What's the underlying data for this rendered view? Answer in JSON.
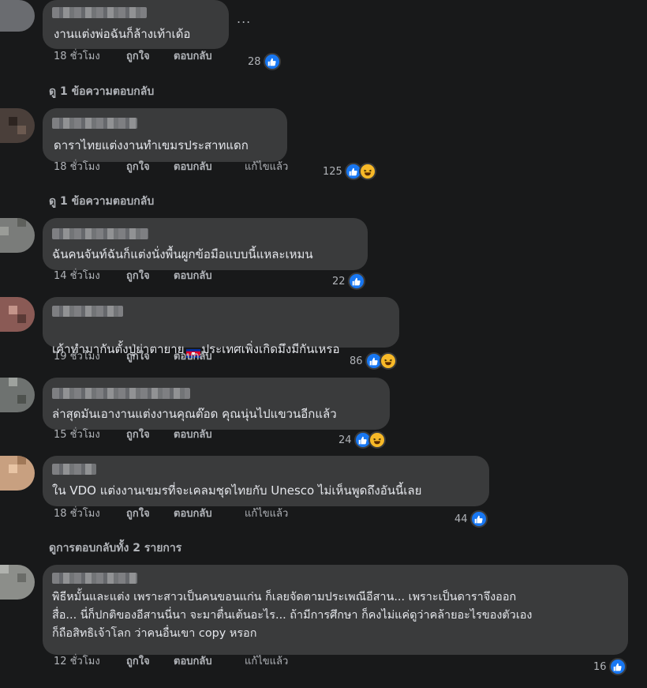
{
  "comments": [
    {
      "text": "งานแต่งพ่อฉันก็ล้างเท้าเด้อ",
      "time": "18 ชั่วโมง",
      "like": "ถูกใจ",
      "reply": "ตอบกลับ",
      "edited": "",
      "count": "28",
      "haha": false
    },
    {
      "text": "ดาราไทยแต่งงานทำเขมรประสาทแดก",
      "time": "18 ชั่วโมง",
      "like": "ถูกใจ",
      "reply": "ตอบกลับ",
      "edited": "แก้ไขแล้ว",
      "count": "125",
      "haha": true
    },
    {
      "text": "ฉันคนจันท์ฉันก็แต่งนั่งพื้นผูกข้อมือแบบนี้แหละเหมน",
      "time": "14 ชั่วโมง",
      "like": "ถูกใจ",
      "reply": "ตอบกลับ",
      "edited": "",
      "count": "22",
      "haha": false
    },
    {
      "text_a": "เค้าทำมากันตั้งปู่ย่าตายาย",
      "text_b": "ประเทศเพิ่งเกิดมึงมีกันเหรอ",
      "time": "19 ชั่วโมง",
      "like": "ถูกใจ",
      "reply": "ตอบกลับ",
      "edited": "",
      "count": "86",
      "haha": true
    },
    {
      "text": "ล่าสุดมันเอางานแต่งงานคุณต๊อด คุณนุ่นไปแขวนอีกแล้ว",
      "time": "15 ชั่วโมง",
      "like": "ถูกใจ",
      "reply": "ตอบกลับ",
      "edited": "",
      "count": "24",
      "haha": true
    },
    {
      "text": "ใน VDO แต่งงานเขมรที่จะเคลมชุดไทยกับ Unesco ไม่เห็นพูดถึงอันนี้เลย",
      "time": "18 ชั่วโมง",
      "like": "ถูกใจ",
      "reply": "ตอบกลับ",
      "edited": "แก้ไขแล้ว",
      "count": "44",
      "haha": false
    },
    {
      "text": "พิธีหมั้นและแต่ง เพราะสาวเป็นคนขอนแก่น ก็เลยจัดตามประเพณีอีสาน... เพราะเป็นดาราจึงออก\nสื่อ... นี่ก็ปกติของอีสานนี่นา จะมาตื่นเต้นอะไร... ถ้ามีการศึกษา ก็คงไม่แค่ดูว่าคล้ายอะไรของตัวเอง\nก็ถือสิทธิเจ้าโลก ว่าคนอื่นเขา copy หรอก",
      "time": "12 ชั่วโมง",
      "like": "ถูกใจ",
      "reply": "ตอบกลับ",
      "edited": "แก้ไขแล้ว",
      "count": "16",
      "haha": false
    }
  ],
  "view_replies": [
    "ดู 1 ข้อความตอบกลับ",
    "ดู 1 ข้อความตอบกลับ",
    "ดูการตอบกลับทั้ง 2 รายการ"
  ],
  "more_dots": "...",
  "icons": {
    "like": "like-reaction-icon",
    "haha": "haha-reaction-icon",
    "flag": "cambodia-flag-icon"
  },
  "colors": {
    "background": "#18191a",
    "bubble": "#3a3b3c",
    "text": "#e4e6eb",
    "meta": "#b0b3b8",
    "like": "#1877f2",
    "haha": "#f7b928"
  }
}
